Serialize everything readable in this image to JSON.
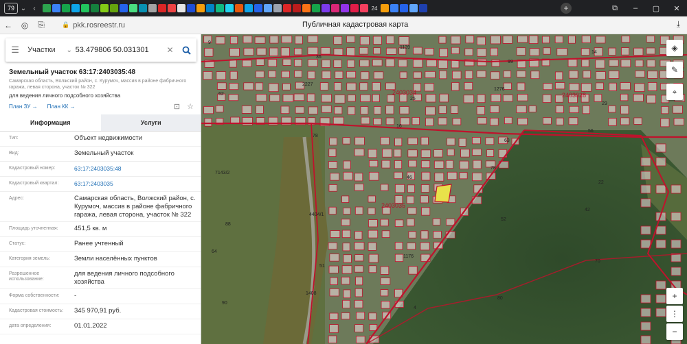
{
  "browser": {
    "tab_count": "79",
    "fav_label": "24",
    "url": "pkk.rosreestr.ru",
    "page_title": "Публичная кадастровая карта"
  },
  "search": {
    "category": "Участки",
    "query": "53.479806 50.031301"
  },
  "object": {
    "title": "Земельный участок 63:17:2403035:48",
    "address_short": "Самарская область, Волжский район, с. Курумоч, массив в районе фабричного гаража, левая сторона, участок № 322",
    "use": "для ведения личного подсобного хозяйства",
    "plan_zu": "План ЗУ",
    "plan_kk": "План КК"
  },
  "tabs": {
    "info": "Информация",
    "services": "Услуги"
  },
  "rows": [
    {
      "k": "Тип:",
      "v": "Объект недвижимости"
    },
    {
      "k": "Вид:",
      "v": "Земельный участок"
    },
    {
      "k": "Кадастровый номер:",
      "v": "63:17:2403035:48"
    },
    {
      "k": "Кадастровый квартал:",
      "v": "63:17:2403035"
    },
    {
      "k": "Адрес:",
      "v": "Самарская область, Волжский район, с. Курумоч, массив в районе фабричного гаража, левая сторона, участок № 322"
    },
    {
      "k": "Площадь уточненная:",
      "v": "451,5 кв. м"
    },
    {
      "k": "Статус:",
      "v": "Ранее учтенный"
    },
    {
      "k": "Категория земель:",
      "v": "Земли населённых пунктов"
    },
    {
      "k": "Разрешенное использование:",
      "v": "для ведения личного подсобного хозяйства"
    },
    {
      "k": "Форма собственности:",
      "v": "-"
    },
    {
      "k": "Кадастровая стоимость:",
      "v": "345 970,91 руб."
    },
    {
      "k": "дата определения:",
      "v": "01.01.2022"
    }
  ],
  "map": {
    "quarter_labels": [
      "2403034",
      "2403028",
      "2403035"
    ],
    "parcel_labels": [
      "9",
      "2227",
      "16",
      "78",
      "42",
      "64",
      "1408",
      "1139",
      "1276",
      "56",
      "7143/2",
      "4404/1",
      "1176",
      "80",
      "14",
      "62",
      "78",
      "46",
      "52",
      "70",
      "90",
      "36",
      "25",
      "63",
      "22",
      "88",
      "51",
      "4",
      "99",
      "29"
    ]
  },
  "colors": {
    "boundary": "#c0122c",
    "parcel_fill": "#f5e0e3",
    "highlight": "#e8e24a",
    "link": "#1e6eb5"
  }
}
